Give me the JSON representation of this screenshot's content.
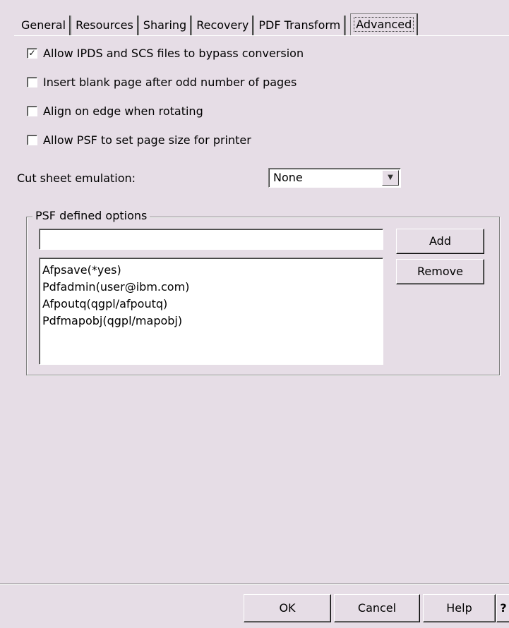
{
  "tabs": [
    "General",
    "Resources",
    "Sharing",
    "Recovery",
    "PDF Transform",
    "Advanced"
  ],
  "active_tab": "Advanced",
  "checkboxes": [
    {
      "label": "Allow IPDS and SCS files to bypass conversion",
      "checked": true
    },
    {
      "label": "Insert blank page after odd number of pages",
      "checked": false
    },
    {
      "label": "Align on edge when rotating",
      "checked": false
    },
    {
      "label": "Allow PSF to set page size for printer",
      "checked": false
    }
  ],
  "cut_sheet": {
    "label": "Cut sheet emulation:",
    "value": "None"
  },
  "psf": {
    "group_title": "PSF defined options",
    "input_value": "",
    "add_label": "Add",
    "remove_label": "Remove",
    "options": [
      "Afpsave(*yes)",
      "Pdfadmin(user@ibm.com)",
      "Afpoutq(qgpl/afpoutq)",
      "Pdfmapobj(qgpl/mapobj)"
    ]
  },
  "footer": {
    "ok": "OK",
    "cancel": "Cancel",
    "help": "Help",
    "whats_this": "?"
  }
}
